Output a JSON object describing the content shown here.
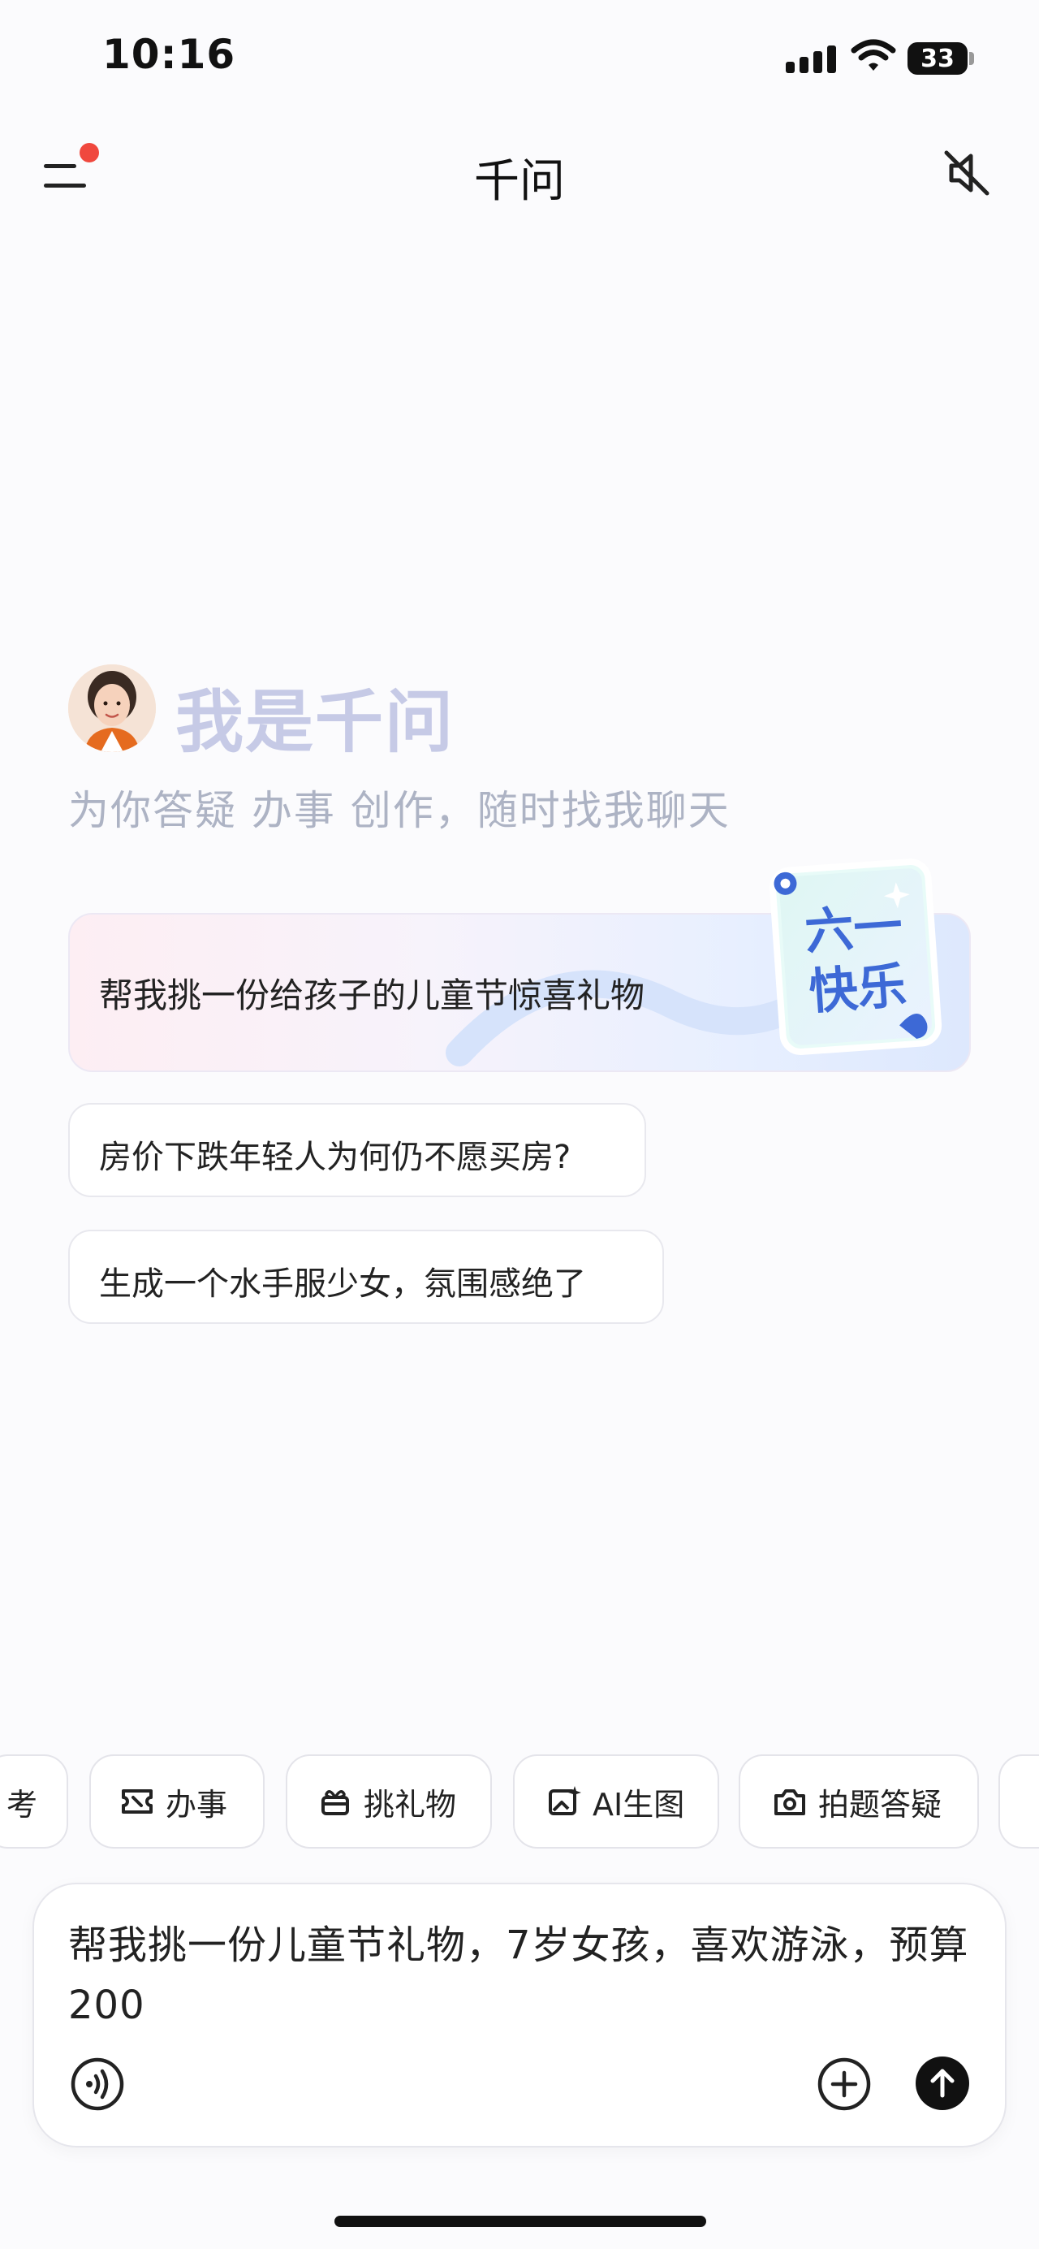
{
  "status_bar": {
    "time": "10:16",
    "battery": "33"
  },
  "header": {
    "title": "千问",
    "menu_icon": "menu-icon",
    "mute_icon": "speaker-muted-icon"
  },
  "hero": {
    "title": "我是千问",
    "subtitle": "为你答疑 办事 创作，随时找我聊天"
  },
  "suggestions": [
    {
      "text": "帮我挑一份给孩子的儿童节惊喜礼物"
    },
    {
      "text": "房价下跌年轻人为何仍不愿买房?"
    },
    {
      "text": "生成一个水手服少女，氛围感绝了"
    }
  ],
  "festive_badge": {
    "line1": "六一",
    "line2": "快乐"
  },
  "chips": [
    {
      "label": "考",
      "icon": ""
    },
    {
      "label": "办事",
      "icon": "ticket-icon"
    },
    {
      "label": "挑礼物",
      "icon": "gift-icon"
    },
    {
      "label": "AI生图",
      "icon": "image-sparkle-icon"
    },
    {
      "label": "拍题答疑",
      "icon": "camera-icon"
    }
  ],
  "input": {
    "value": "帮我挑一份儿童节礼物，7岁女孩，喜欢游泳，预算200",
    "voice_icon": "voice-icon",
    "plus_icon": "plus-circle-icon",
    "send_icon": "send-arrow-icon"
  },
  "colors": {
    "hero_title": "#c6cae6",
    "hero_subtitle": "#adb3c4",
    "notification_dot": "#f0483e",
    "badge_blue": "#3d69d6"
  }
}
